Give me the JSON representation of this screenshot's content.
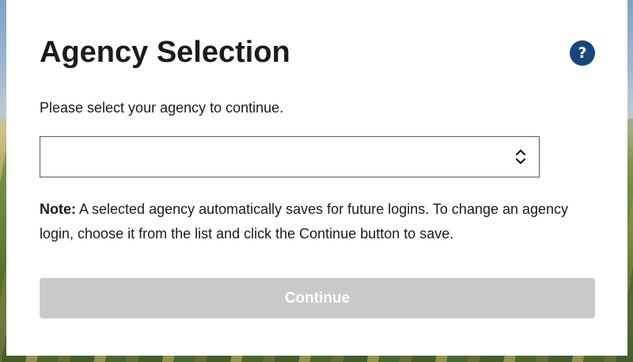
{
  "dialog": {
    "title": "Agency Selection",
    "help_icon": "question-mark-icon",
    "help_glyph": "?",
    "instruction": "Please select your agency to continue.",
    "agency_select": {
      "value": "",
      "icon": "chevron-up-down-icon"
    },
    "note": {
      "label": "Note:",
      "text": " A selected agency automatically saves for future logins. To change an agency login, choose it from the list and click the Continue button to save."
    },
    "continue_label": "Continue",
    "continue_disabled": true
  },
  "colors": {
    "help_button": "#1a4480",
    "disabled_button": "#c9c9c9",
    "text": "#1b1b1b"
  }
}
